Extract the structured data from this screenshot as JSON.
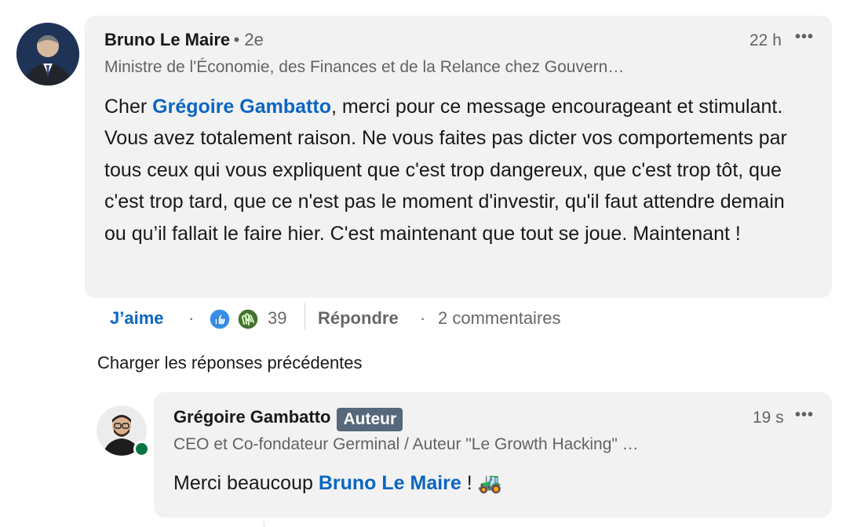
{
  "comment": {
    "author": "Bruno Le Maire",
    "degree": "• 2e",
    "headline": "Ministre de l'Économie, des Finances et de la Relance chez Gouvern…",
    "time": "22 h",
    "text_before": "Cher ",
    "mention": "Grégoire Gambatto",
    "text_after": ", merci pour ce message encourageant et stimulant. Vous avez totalement raison. Ne vous faites pas dicter vos comportements par tous ceux qui vous expliquent que c'est trop dangereux, que c'est trop tôt, que c'est trop tard, que ce n'est pas le moment d'investir, qu'il faut attendre demain ou qu’il fallait le faire hier. C'est maintenant que tout se joue. Maintenant !"
  },
  "actions": {
    "like": "J’aime",
    "sep1": "·",
    "reactions_count": "39",
    "reply": "Répondre",
    "sep2": "·",
    "comments": "2 commentaires"
  },
  "load_previous": "Charger les réponses précédentes",
  "reply": {
    "author": "Grégoire Gambatto",
    "badge": "Auteur",
    "headline": "CEO et Co-fondateur Germinal / Auteur \"Le Growth Hacking\" …",
    "time": "19 s",
    "text_before": "Merci beaucoup ",
    "mention": "Bruno Le Maire",
    "text_after": " ! ",
    "emoji": "🚜"
  },
  "icons": {
    "more": "more-horizontal-icon",
    "like_reaction": "thumbs-up-reaction-icon",
    "celebrate_reaction": "clapping-hands-reaction-icon",
    "online": "online-status-dot"
  },
  "colors": {
    "link": "#0a66c2",
    "bubble": "#f2f2f2",
    "badge": "#56687a",
    "online": "#057642"
  }
}
